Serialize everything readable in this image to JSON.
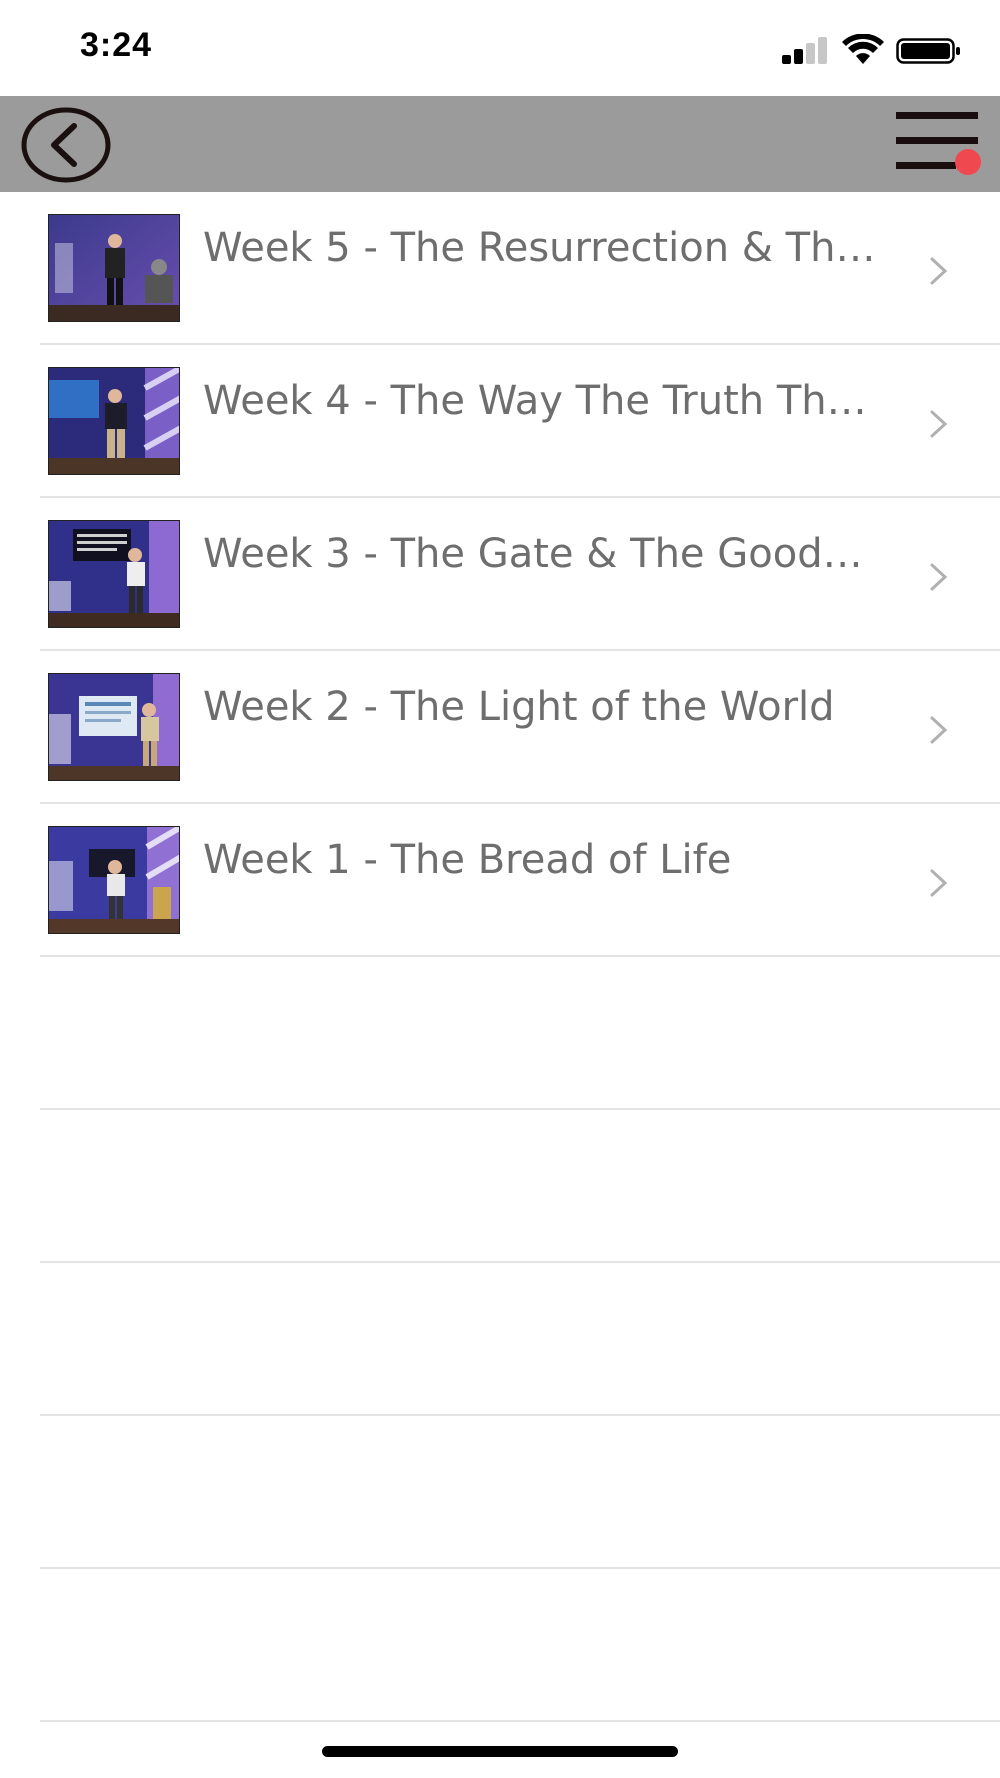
{
  "status_bar": {
    "time": "3:24",
    "icons": [
      "cellular-signal-icon",
      "wifi-icon",
      "battery-icon"
    ]
  },
  "nav_bar": {
    "back_icon": "circle-chevron-left-icon",
    "menu_icon": "hamburger-menu-icon",
    "menu_badge_color": "#f0484f",
    "background_color": "#9b9b9b"
  },
  "sermons": [
    {
      "title": "Week 5 - The Resurrection & Th…"
    },
    {
      "title": "Week 4 - The Way The Truth Th…"
    },
    {
      "title": "Week 3 - The Gate & The Good…"
    },
    {
      "title": "Week 2 - The Light of the World"
    },
    {
      "title": "Week 1 - The Bread of Life"
    }
  ],
  "colors": {
    "title_text": "#6e6e6e",
    "chevron": "#b0b0b0",
    "separator": "#e3e3e3"
  }
}
